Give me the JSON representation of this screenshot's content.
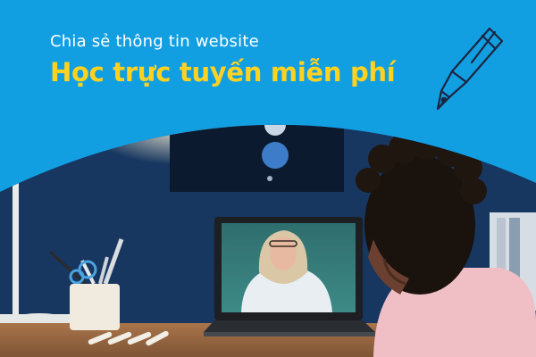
{
  "banner": {
    "subtitle": "Chia sẻ thông tin website",
    "headline": "Học trực tuyến miễn phí"
  },
  "icons": {
    "pen": "fountain-pen-icon"
  },
  "colors": {
    "background": "#129fe2",
    "headline": "#ffd21f",
    "subtitle": "#ffffff",
    "wall": "#1a3a66"
  }
}
